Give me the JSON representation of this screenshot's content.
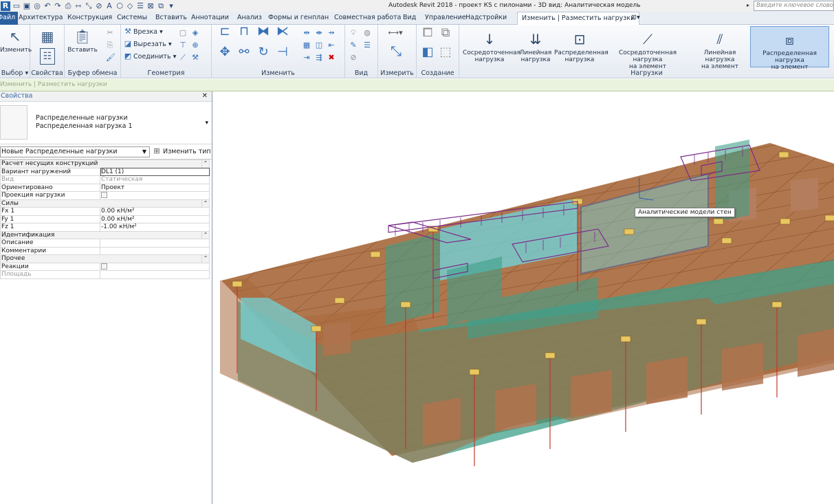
{
  "title_bar": {
    "app_title": "Autodesk Revit 2018 -    проект КS с пилонами - 3D вид: Аналитическая модель",
    "search_placeholder": "Введите ключевое слово/фразу"
  },
  "tabs": {
    "file": "Файл",
    "items": [
      "Архитектура",
      "Конструкция",
      "Системы",
      "Вставить",
      "Аннотации",
      "Анализ",
      "Формы и генплан",
      "Совместная работа",
      "Вид",
      "Управление",
      "Надстройки"
    ],
    "active": "Изменить | Разместить нагрузки"
  },
  "ribbon": {
    "select_panel": {
      "modify_label": "Изменить",
      "title": "Выбор ▾"
    },
    "properties_panel": {
      "title": "Свойства"
    },
    "clipboard_panel": {
      "paste_label": "Вставить",
      "title": "Буфер обмена"
    },
    "geometry_panel": {
      "cope": "Врезка ▾",
      "cut": "Вырезать ▾",
      "join": "Соединить ▾",
      "title": "Геометрия"
    },
    "modify_panel": {
      "title": "Изменить"
    },
    "view_panel": {
      "title": "Вид"
    },
    "measure_panel": {
      "title": "Измерить"
    },
    "create_panel": {
      "title": "Создание"
    },
    "loads_panel": {
      "title": "Нагрузки",
      "buttons": [
        {
          "line1": "Сосредоточенная",
          "line2": "нагрузка",
          "icon": "point-load-icon"
        },
        {
          "line1": "Линейная",
          "line2": "нагрузка",
          "icon": "line-load-icon"
        },
        {
          "line1": "Распределенная",
          "line2": "нагрузка",
          "icon": "area-load-icon"
        },
        {
          "line1": "Сосредоточенная нагрузка",
          "line2": "на элемент",
          "icon": "hosted-point-load-icon"
        },
        {
          "line1": "Линейная нагрузка",
          "line2": "на элемент",
          "icon": "hosted-line-load-icon"
        },
        {
          "line1": "Распределенная нагрузка",
          "line2": "на элемент",
          "icon": "hosted-area-load-icon",
          "selected": true
        }
      ]
    }
  },
  "context_bar": {
    "text": "Изменить | Разместить нагрузки"
  },
  "properties": {
    "header": "Свойства",
    "type_family": "Распределенные нагрузки",
    "type_name": "Распределенная нагрузка 1",
    "instance_dropdown": "Новые Распределенные нагрузки",
    "edit_type": "Изменить тип",
    "groups": [
      {
        "name": "Расчет несущих конструкций",
        "rows": [
          {
            "name": "Вариант нагружений",
            "value": "DL1 (1)",
            "dim": false,
            "boxed": true
          },
          {
            "name": "Вид",
            "value": "Статическая",
            "dim": true
          },
          {
            "name": "Ориентировано",
            "value": "Проект",
            "dim": false
          },
          {
            "name": "Проекция нагрузки",
            "value": "",
            "checkbox": true
          }
        ]
      },
      {
        "name": "Силы",
        "rows": [
          {
            "name": "Fx 1",
            "value": "0.00 кН/м²"
          },
          {
            "name": "Fy 1",
            "value": "0.00 кН/м²"
          },
          {
            "name": "Fz 1",
            "value": "-1.00 кН/м²"
          }
        ]
      },
      {
        "name": "Идентификация",
        "rows": [
          {
            "name": "Описание",
            "value": ""
          },
          {
            "name": "Комментарии",
            "value": ""
          }
        ]
      },
      {
        "name": "Прочее",
        "rows": [
          {
            "name": "Реакции",
            "value": "",
            "checkbox": true
          },
          {
            "name": "Площадь",
            "value": "",
            "dim": true
          }
        ]
      }
    ]
  },
  "viewport": {
    "tooltip": "Аналитические модели стен",
    "colors": {
      "slab": "#a96a3e",
      "wall": "#3fa08a",
      "wall_selected": "#6fd8e0",
      "load": "#7b2c8a",
      "grid": "#8a4a1e"
    }
  }
}
